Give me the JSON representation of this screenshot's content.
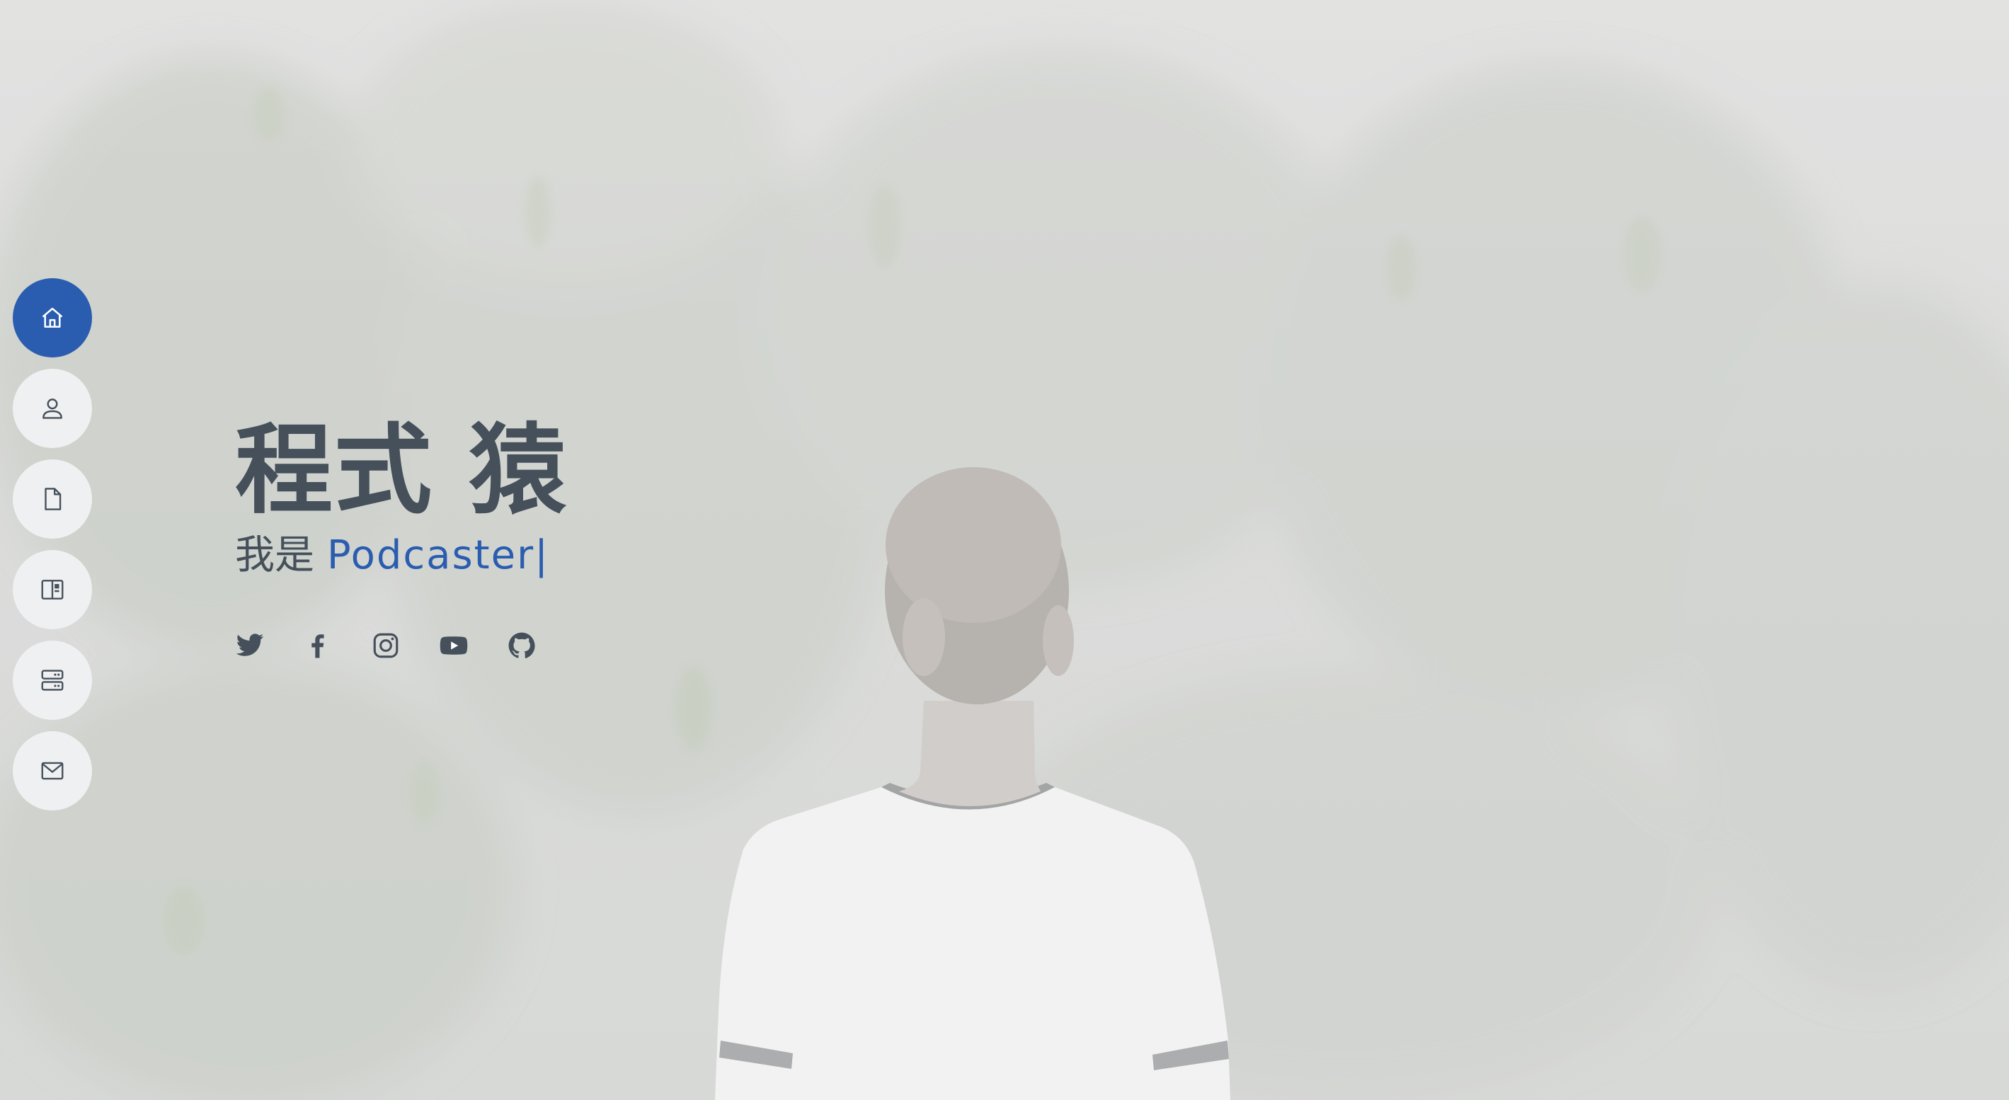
{
  "hero": {
    "name": "程式 猿",
    "typed_prefix": "我是 ",
    "typed_word": "Podcaster",
    "cursor": "|"
  },
  "nav": {
    "items": [
      {
        "icon": "home-icon",
        "active": true
      },
      {
        "icon": "person-icon",
        "active": false
      },
      {
        "icon": "file-icon",
        "active": false
      },
      {
        "icon": "book-half-icon",
        "active": false
      },
      {
        "icon": "server-icon",
        "active": false
      },
      {
        "icon": "envelope-icon",
        "active": false
      }
    ]
  },
  "social": [
    {
      "icon": "twitter-icon"
    },
    {
      "icon": "facebook-icon"
    },
    {
      "icon": "instagram-icon"
    },
    {
      "icon": "youtube-icon"
    },
    {
      "icon": "github-icon"
    }
  ],
  "colors": {
    "accent": "#2a5db0",
    "text": "#45505b",
    "nav_bg": "#eff0f1",
    "overlay": "#d6d7d6"
  }
}
